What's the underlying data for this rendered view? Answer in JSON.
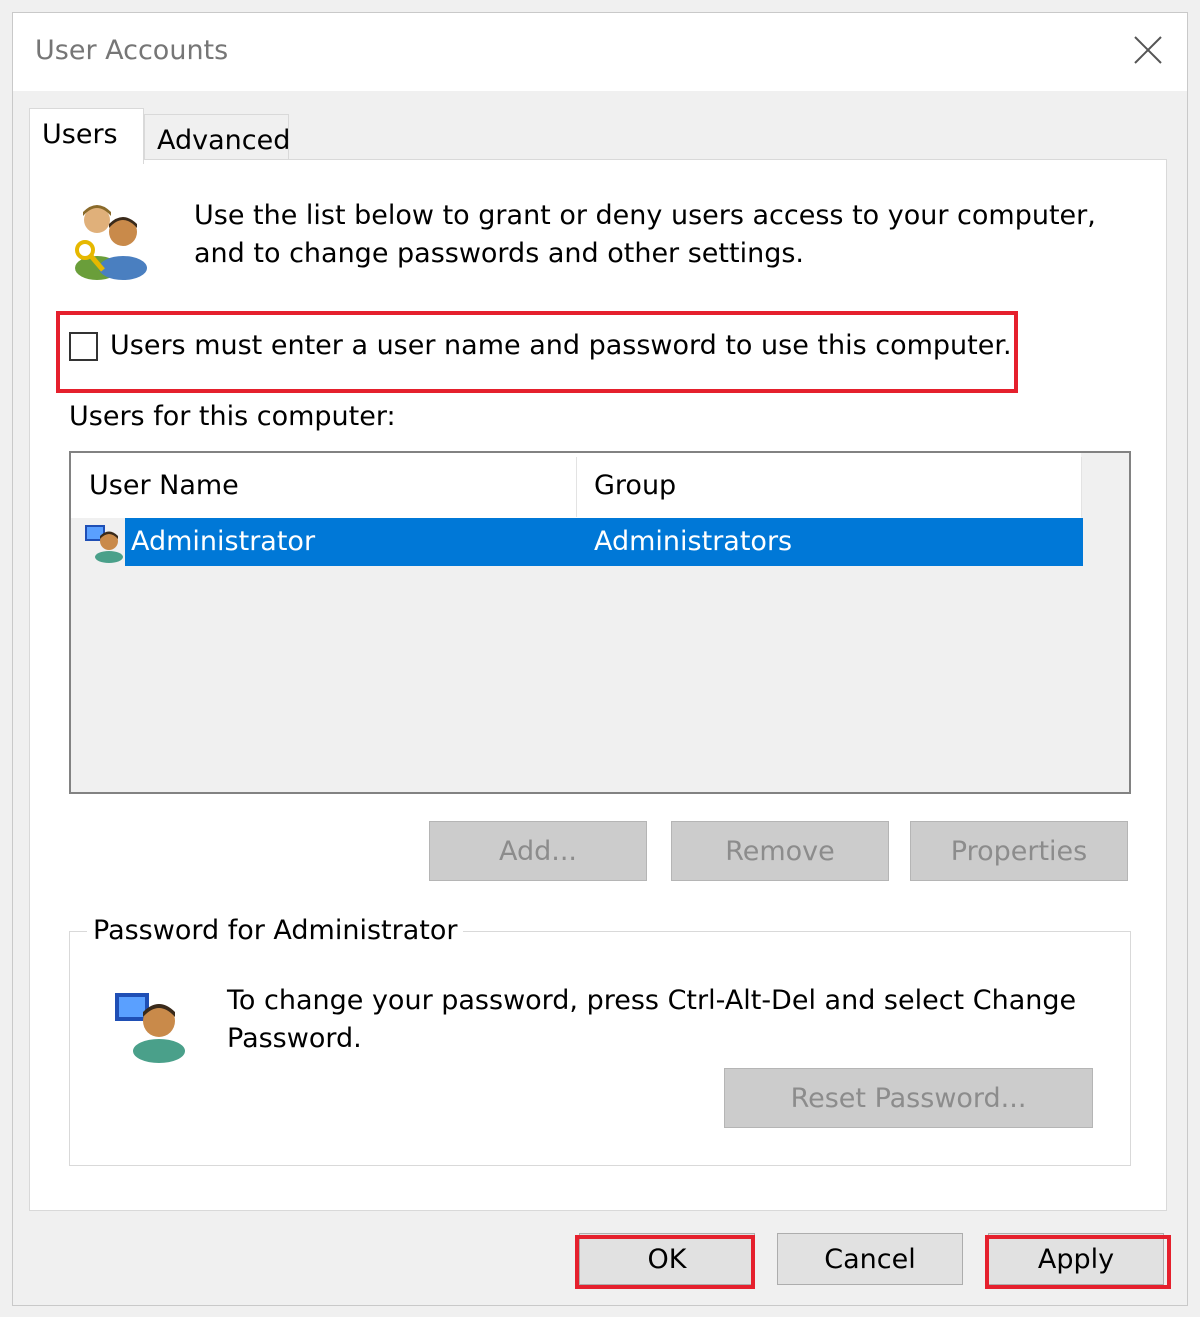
{
  "window": {
    "title": "User Accounts"
  },
  "tabs": [
    {
      "label": "Users"
    },
    {
      "label": "Advanced"
    }
  ],
  "intro": {
    "line1": "Use the list below to grant or deny users access to your computer,",
    "line2": "and to change passwords and other settings."
  },
  "require_password": {
    "label": "Users must enter a user name and password to use this computer.",
    "checked": false
  },
  "users_label": "Users for this computer:",
  "users_table": {
    "columns": [
      "User Name",
      "Group"
    ],
    "rows": [
      {
        "user_name": "Administrator",
        "group": "Administrators",
        "selected": true
      }
    ]
  },
  "list_buttons": {
    "add": "Add...",
    "remove": "Remove",
    "properties": "Properties"
  },
  "password_group": {
    "title": "Password for Administrator",
    "line1": "To change your password, press Ctrl-Alt-Del and select Change",
    "line2": "Password.",
    "reset_button": "Reset Password..."
  },
  "footer": {
    "ok": "OK",
    "cancel": "Cancel",
    "apply": "Apply"
  },
  "colors": {
    "selection": "#0078d7",
    "highlight": "#e5202d",
    "disabled_text": "#8c8c8c"
  },
  "icons": [
    "users-key-icon",
    "user-row-icon",
    "user-computer-icon",
    "close-icon"
  ]
}
